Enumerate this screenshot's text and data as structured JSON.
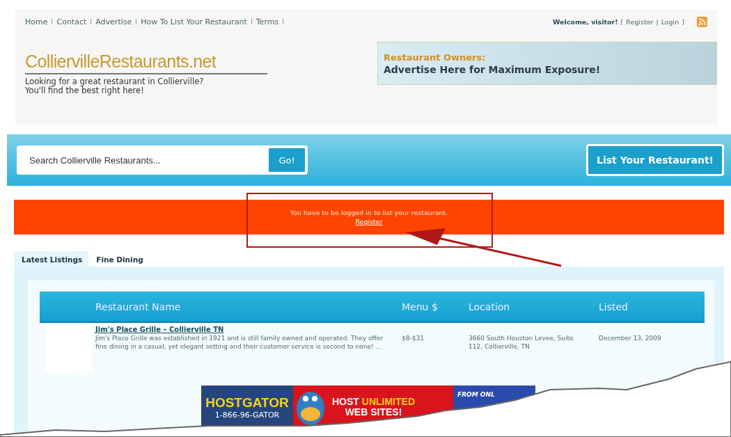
{
  "nav": [
    {
      "label": "Home"
    },
    {
      "label": "Contact"
    },
    {
      "label": "Advertise"
    },
    {
      "label": "How To List Your Restaurant"
    },
    {
      "label": "Terms"
    }
  ],
  "user": {
    "welcome": "Welcome, visitor!",
    "open": "[",
    "register": "Register",
    "sep": "|",
    "login": "Login",
    "close": "]"
  },
  "logo": {
    "title": "ColliervilleRestaurants.net",
    "tagline": "Looking for a great restaurant in Collierville?\nYou'll find the best right here!"
  },
  "header_ad": {
    "heading": "Restaurant Owners:",
    "text": "Advertise Here for Maximum Exposure!"
  },
  "search": {
    "placeholder": "Search Collierville Restaurants...",
    "button": "Go!"
  },
  "list_button": "List Your Restaurant!",
  "alert": {
    "message": "You have to be logged in to list your restaurant.",
    "link": "Register"
  },
  "tabs": [
    {
      "label": "Latest Listings",
      "selected": true
    },
    {
      "label": "Fine Dining",
      "selected": false
    }
  ],
  "table": {
    "columns": [
      "Restaurant Name",
      "Menu $",
      "Location",
      "Listed"
    ],
    "rows": [
      {
        "name": "Jim's Place Grille – Collierville TN",
        "description": "Jim's Place Grille was established in 1921 and is still family owned and operated. They offer fine dining in a casual, yet elegant setting and their customer service is second to none! ...",
        "menu": "$8-$31",
        "location": "3660 South Houston Levee, Suite 112, Collierville, TN",
        "listed": "December 13, 2009"
      }
    ]
  },
  "banner": {
    "brand": "HOSTGATOR",
    "phone": "1-866-96-GATOR",
    "headline_1": "HOST",
    "headline_2": "UNLIMITED",
    "headline_3": "WEB SITES!",
    "offer": "FROM ONL"
  }
}
